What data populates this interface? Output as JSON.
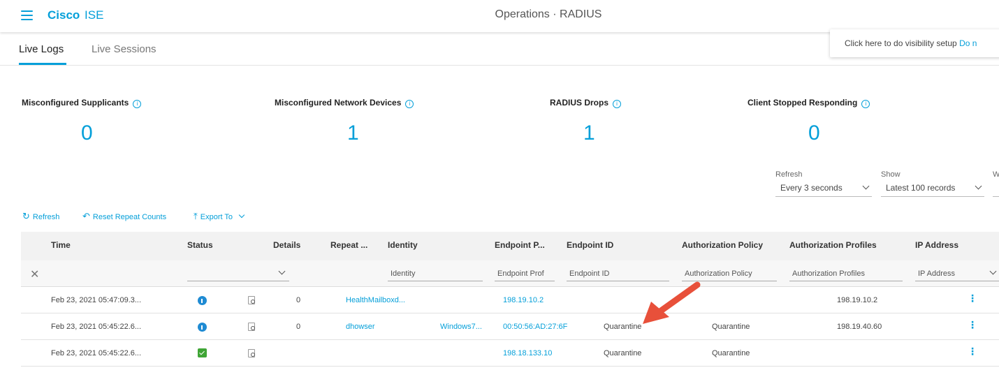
{
  "header": {
    "brand_bold": "Cisco",
    "brand_thin": "ISE",
    "title": "Operations · RADIUS"
  },
  "tabs": [
    {
      "label": "Live Logs",
      "active": true
    },
    {
      "label": "Live Sessions",
      "active": false
    }
  ],
  "popup": {
    "text": "Click here to do visibility setup",
    "link": "Do n"
  },
  "metrics": [
    {
      "label": "Misconfigured Supplicants",
      "value": "0"
    },
    {
      "label": "Misconfigured Network Devices",
      "value": "1"
    },
    {
      "label": "RADIUS Drops",
      "value": "1"
    },
    {
      "label": "Client Stopped Responding",
      "value": "0"
    }
  ],
  "controls": {
    "refresh_label": "Refresh",
    "refresh_value": "Every 3 seconds",
    "show_label": "Show",
    "show_value": "Latest 100 records",
    "within_label": "W"
  },
  "toolbar": {
    "refresh": "Refresh",
    "reset": "Reset Repeat Counts",
    "export": "Export To"
  },
  "table": {
    "columns": [
      "Time",
      "Status",
      "Details",
      "Repeat ...",
      "Identity",
      "Endpoint P...",
      "Endpoint ID",
      "Authorization Policy",
      "Authorization Profiles",
      "IP Address"
    ],
    "filters": {
      "identity": "Identity",
      "endpoint_profile": "Endpoint Prof",
      "endpoint_id": "Endpoint ID",
      "authz_policy": "Authorization Policy",
      "authz_profiles": "Authorization Profiles",
      "ip_address": "IP Address"
    },
    "rows": [
      {
        "time": "Feb 23, 2021 05:47:09.3...",
        "status": "info",
        "repeat": "0",
        "identity": "HealthMailboxd...",
        "endpoint_profile": "",
        "endpoint_id": "198.19.10.2",
        "authz_policy": "",
        "authz_profiles": "",
        "ip": "198.19.10.2"
      },
      {
        "time": "Feb 23, 2021 05:45:22.6...",
        "status": "info",
        "repeat": "0",
        "identity": "dhowser",
        "endpoint_profile": "Windows7...",
        "endpoint_id": "00:50:56:AD:27:6F",
        "authz_policy": "Quarantine",
        "authz_profiles": "Quarantine",
        "ip": "198.19.40.60"
      },
      {
        "time": "Feb 23, 2021 05:45:22.6...",
        "status": "success",
        "repeat": "",
        "identity": "",
        "endpoint_profile": "",
        "endpoint_id": "198.18.133.10",
        "authz_policy": "Quarantine",
        "authz_profiles": "Quarantine",
        "ip": ""
      }
    ]
  },
  "colors": {
    "accent": "#049fd9",
    "annotation_arrow": "#e8503a",
    "status_info": "#1f8bd3",
    "status_success": "#3fa535"
  }
}
